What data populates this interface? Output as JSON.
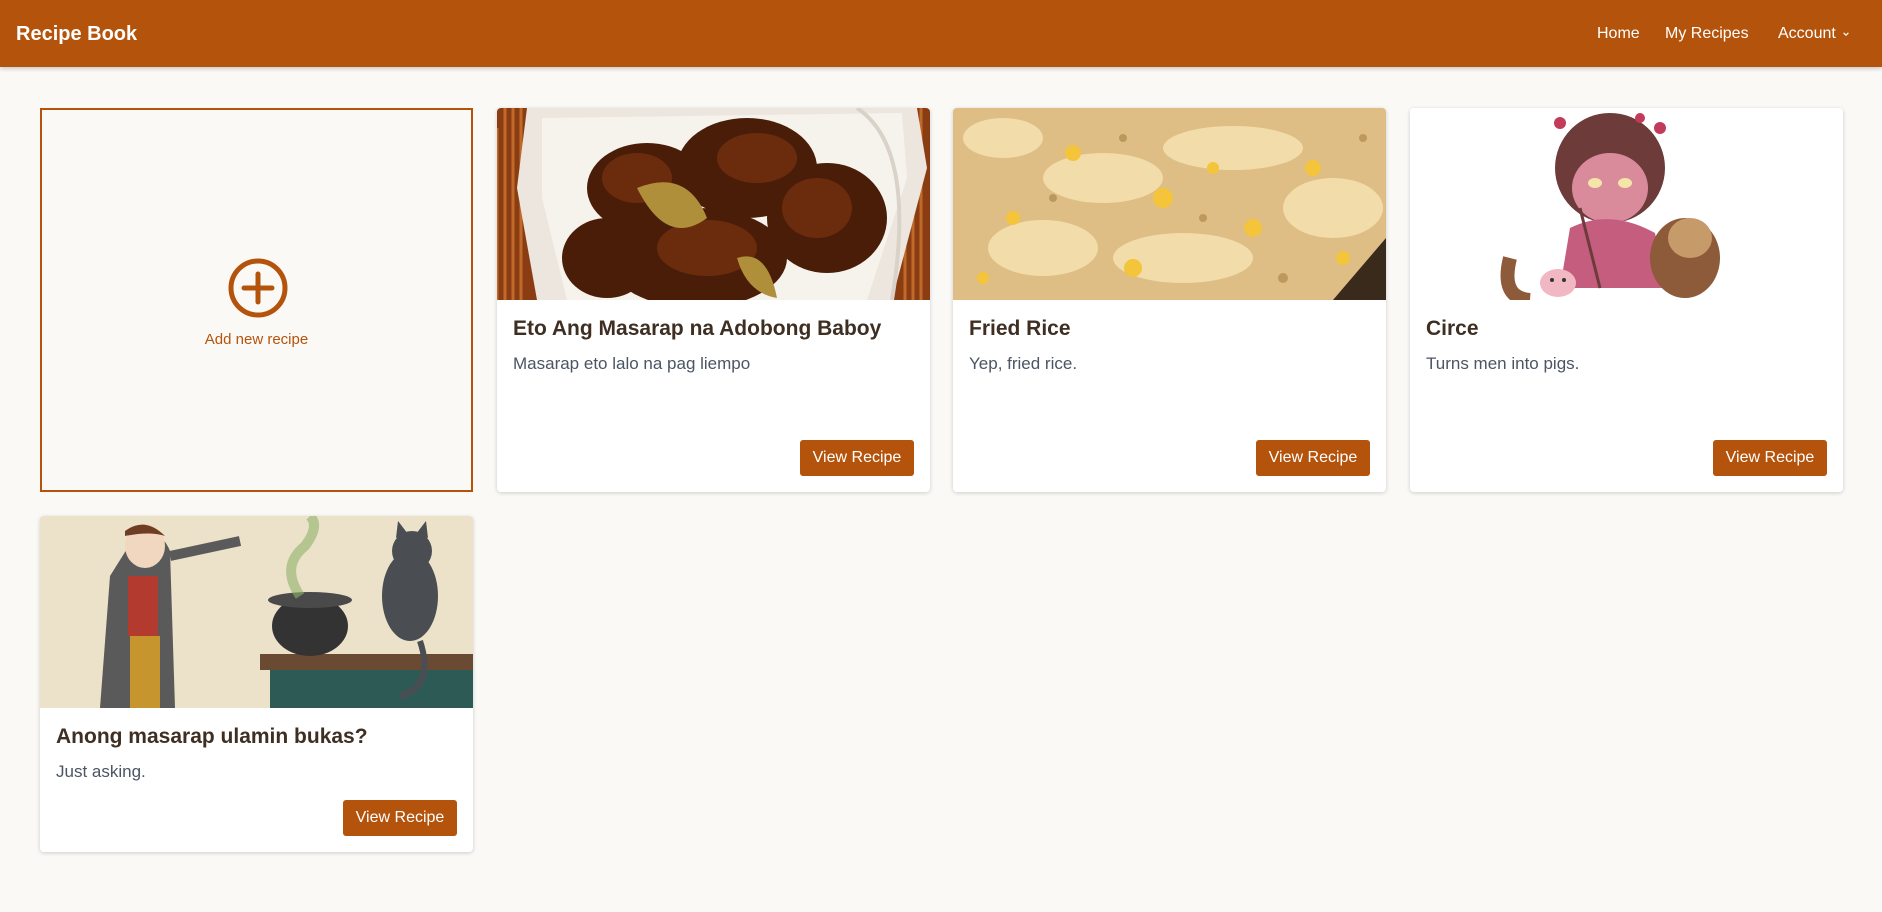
{
  "navbar": {
    "brand": "Recipe Book",
    "home": "Home",
    "my_recipes": "My Recipes",
    "account": "Account"
  },
  "add_card": {
    "label": "Add new recipe"
  },
  "recipes": [
    {
      "title": "Eto Ang Masarap na Adobong Baboy",
      "description": "Masarap eto lalo na pag liempo",
      "button": "View Recipe",
      "image": "adobo-photo"
    },
    {
      "title": "Fried Rice",
      "description": "Yep, fried rice.",
      "button": "View Recipe",
      "image": "fried-rice-photo"
    },
    {
      "title": "Circe",
      "description": "Turns men into pigs.",
      "button": "View Recipe",
      "image": "circe-illustration"
    },
    {
      "title": "Anong masarap ulamin bukas?",
      "description": "Just asking.",
      "button": "View Recipe",
      "image": "witch-cauldron-illustration"
    }
  ],
  "colors": {
    "brand": "#b4530b",
    "background": "#fbf9f6",
    "title_text": "#3f2e22",
    "body_text": "#4b5563"
  }
}
